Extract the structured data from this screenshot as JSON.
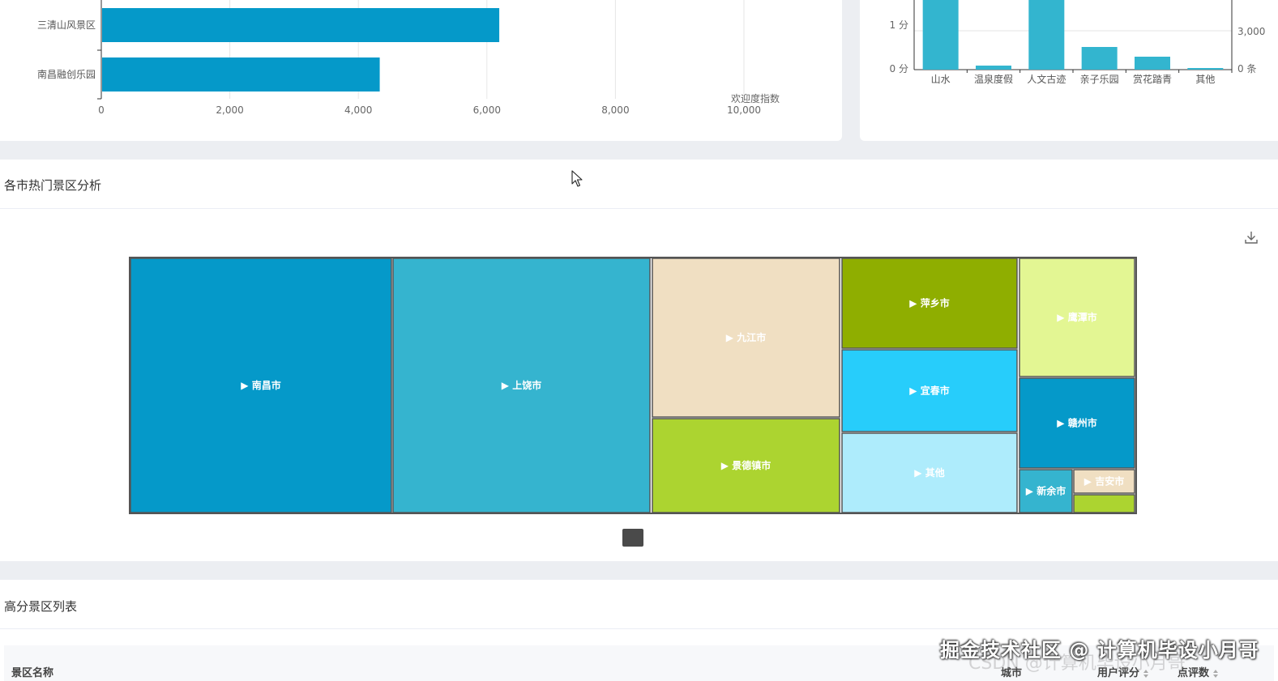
{
  "bar_chart": {
    "categories": [
      "三清山风景区",
      "南昌融创乐园"
    ],
    "values": [
      6180,
      4320
    ],
    "ticks": [
      "0",
      "2,000",
      "4,000",
      "6,000",
      "8,000",
      "10,000"
    ],
    "axis_name": "欢迎度指数",
    "color": "#0599c9"
  },
  "category_chart": {
    "categories": [
      "山水",
      "温泉度假",
      "人文古迹",
      "亲子乐园",
      "赏花踏青",
      "其他"
    ],
    "left_ticks": [
      "0 分",
      "1 分"
    ],
    "right_ticks": [
      "0 条",
      "3,000"
    ],
    "bar_color": "#33b5cf"
  },
  "treemap_section": {
    "title": "各市热门景区分析",
    "download_icon": "download-icon",
    "cells": [
      {
        "label": "▶ 南昌市",
        "color": "#0599c9",
        "text_color": "#ffffff"
      },
      {
        "label": "▶ 上饶市",
        "color": "#35b4cf",
        "text_color": "#ffffff"
      },
      {
        "label": "▶ 九江市",
        "color": "#f0dfc2",
        "text_color": "#ffffff"
      },
      {
        "label": "▶ 景德镇市",
        "color": "#acd430",
        "text_color": "#ffffff"
      },
      {
        "label": "▶ 萍乡市",
        "color": "#8fae00",
        "text_color": "#ffffff"
      },
      {
        "label": "▶ 宜春市",
        "color": "#27cdfb",
        "text_color": "#ffffff"
      },
      {
        "label": "▶ 其他",
        "color": "#aeecfc",
        "text_color": "#ffffff"
      },
      {
        "label": "▶ 鹰潭市",
        "color": "#e3f693",
        "text_color": "#ffffff"
      },
      {
        "label": "▶ 赣州市",
        "color": "#0599c9",
        "text_color": "#ffffff"
      },
      {
        "label": "▶ 新余市",
        "color": "#35b4cf",
        "text_color": "#ffffff"
      },
      {
        "label": "▶ 吉安市",
        "color": "#f0dfc2",
        "text_color": "#ffffff"
      },
      {
        "label": "",
        "color": "#acd430",
        "text_color": "#ffffff"
      }
    ]
  },
  "table_section": {
    "title": "高分景区列表",
    "columns": [
      "景区名称",
      "城市",
      "用户评分",
      "点评数"
    ]
  },
  "watermark": "掘金技术社区 @ 计算机毕设小月哥",
  "watermark_faint": "CSDN @计算机毕设小月哥"
}
